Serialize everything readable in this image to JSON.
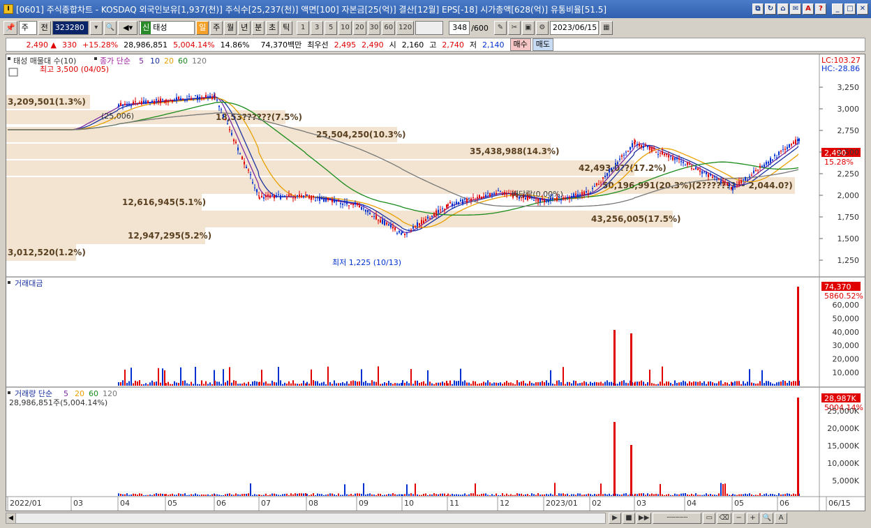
{
  "title": "[0601] 주식종합차트 - KOSDAQ 외국인보유[1,937(천)] 주식수[25,237(천)] 액면[100] 자본금[25(억)] 결산[12월] EPS[-18] 시가총액[628(억)] 유통비율[51.5]",
  "toolbar": {
    "type_select": "주",
    "prev_label": "전",
    "code": "323280",
    "stock_name": "태성",
    "stock_prefix": "신",
    "period_buttons": [
      "일",
      "주",
      "월",
      "년",
      "분",
      "초",
      "틱"
    ],
    "interval_buttons": [
      "1",
      "3",
      "5",
      "10",
      "20",
      "30",
      "60",
      "120"
    ],
    "count": "348",
    "count_total": "/600",
    "date": "2023/06/15"
  },
  "quote": {
    "price": "2,490",
    "change": "330",
    "change_pct": "+15.28%",
    "volume": "28,986,851",
    "volume_pct": "5,004.14%",
    "turnover": "14.86%",
    "amount": "74,370백만",
    "best_label": "최우선",
    "ask": "2,495",
    "bid": "2,490",
    "open_label": "시",
    "open": "2,160",
    "high_label": "고",
    "high": "2,740",
    "low_label": "저",
    "low": "2,140",
    "buy_label": "매수",
    "sell_label": "매도"
  },
  "colors": {
    "up": "#e00000",
    "down": "#0030d0",
    "ma5": "#7a2aa0",
    "ma10": "#1a30a0",
    "ma20": "#e8a000",
    "ma60": "#1a8a1a",
    "ma120": "#777777",
    "profile": "#f2e4d0"
  },
  "price_panel": {
    "legend": {
      "name": "태성 매물대 수(10)",
      "ma_label": "종가 단순",
      "periods": [
        "5",
        "10",
        "20",
        "60",
        "120"
      ]
    },
    "lc_label": "LC:103.27",
    "hc_label": "HC:-28.86",
    "y_ticks": [
      "3,250",
      "3,000",
      "2,750",
      "2,500",
      "2,250",
      "2,000",
      "1,750",
      "1,500",
      "1,250"
    ],
    "last_price_tag": "2,490",
    "last_pct_tag": "15.28%",
    "high_note": "최고 3,500 (04/05)",
    "low_note": "최저 1,225 (10/13)",
    "div_note": "배당락(0.00%)",
    "first_note": "(25,006)",
    "profile_labels": [
      "3,209,501(1.3%)",
      "18,53??????(7.5%)",
      "25,504,250(10.3%)",
      "35,438,988(14.3%)",
      "42,493,0??(17.2%)",
      "50,196,991(20.3%)(2??????? ~ 2,044.0?)",
      "12,616,945(5.1%)",
      "43,256,005(17.5%)",
      "12,947,295(5.2%)",
      "3,012,520(1.2%)"
    ]
  },
  "amount_panel": {
    "legend": "거래대금",
    "y_ticks": [
      "60,000",
      "50,000",
      "40,000",
      "30,000",
      "20,000",
      "10,000"
    ],
    "last_tag": "74,370",
    "pct_tag": "5860.52%"
  },
  "volume_panel": {
    "legend": "거래량 단순",
    "periods": [
      "5",
      "20",
      "60",
      "120"
    ],
    "sub_label": "28,986,851주(5,004.14%)",
    "y_ticks": [
      "25,000K",
      "20,000K",
      "15,000K",
      "10,000K",
      "5,000K"
    ],
    "last_tag": "28,987K",
    "pct_tag": "5004.14%"
  },
  "x_axis": [
    "2022/01",
    "03",
    "04",
    "05",
    "06",
    "07",
    "08",
    "09",
    "10",
    "11",
    "12",
    "2023/01",
    "02",
    "03",
    "04",
    "05",
    "06",
    "06/15"
  ],
  "chart_data": {
    "type": "candlestick",
    "x": [
      "2022/01",
      "2022/03",
      "2022/04",
      "2022/05",
      "2022/06",
      "2022/07",
      "2022/08",
      "2022/09",
      "2022/10",
      "2022/11",
      "2022/12",
      "2023/01",
      "2023/02",
      "2023/03",
      "2023/04",
      "2023/05",
      "2023/06"
    ],
    "approx_close": [
      2600,
      2600,
      2900,
      2950,
      3000,
      1800,
      1800,
      1700,
      1350,
      1700,
      1850,
      1750,
      1850,
      2450,
      2200,
      1900,
      2490
    ],
    "ylim": [
      1100,
      3500
    ]
  }
}
